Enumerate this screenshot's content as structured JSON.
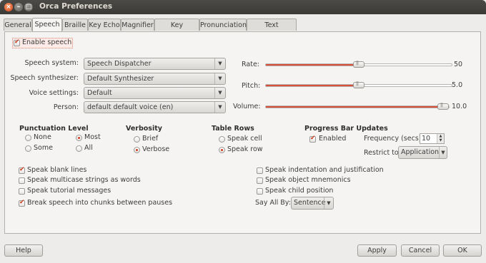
{
  "window": {
    "title": "Orca Preferences"
  },
  "tabs": [
    "General",
    "Speech",
    "Braille",
    "Key Echo",
    "Magnifier",
    "Key Bindings",
    "Pronunciation",
    "Text Attributes"
  ],
  "speech": {
    "enable_label": "Enable speech",
    "system_label": "Speech system:",
    "system_value": "Speech Dispatcher",
    "synth_label": "Speech synthesizer:",
    "synth_value": "Default Synthesizer",
    "voice_label": "Voice settings:",
    "voice_value": "Default",
    "person_label": "Person:",
    "person_value": "default default voice (en)"
  },
  "sliders": {
    "rate_label": "Rate:",
    "rate_value": "50",
    "pitch_label": "Pitch:",
    "pitch_value": "5.0",
    "volume_label": "Volume:",
    "volume_value": "10.0",
    "rate_fraction": 0.5,
    "pitch_fraction": 0.5,
    "volume_fraction": 1.0
  },
  "punctuation": {
    "heading": "Punctuation Level",
    "none": "None",
    "some": "Some",
    "most": "Most",
    "all": "All",
    "selected": "Most"
  },
  "verbosity": {
    "heading": "Verbosity",
    "brief": "Brief",
    "verbose": "Verbose",
    "selected": "Verbose"
  },
  "table_rows": {
    "heading": "Table Rows",
    "cell": "Speak cell",
    "row": "Speak row",
    "selected": "Speak row"
  },
  "progress": {
    "heading": "Progress Bar Updates",
    "enabled_label": "Enabled",
    "freq_label": "Frequency (secs):",
    "freq_value": "10",
    "restrict_label": "Restrict to:",
    "restrict_value": "Application"
  },
  "options": {
    "blank_lines": "Speak blank lines",
    "multicase": "Speak multicase strings as words",
    "tutorial": "Speak tutorial messages",
    "chunks": "Break speech into chunks between pauses",
    "indentation": "Speak indentation and justification",
    "mnemonics": "Speak object mnemonics",
    "child_position": "Speak child position",
    "say_all_label": "Say All By:",
    "say_all_value": "Sentence"
  },
  "buttons": {
    "help": "Help",
    "apply": "Apply",
    "cancel": "Cancel",
    "ok": "OK"
  }
}
